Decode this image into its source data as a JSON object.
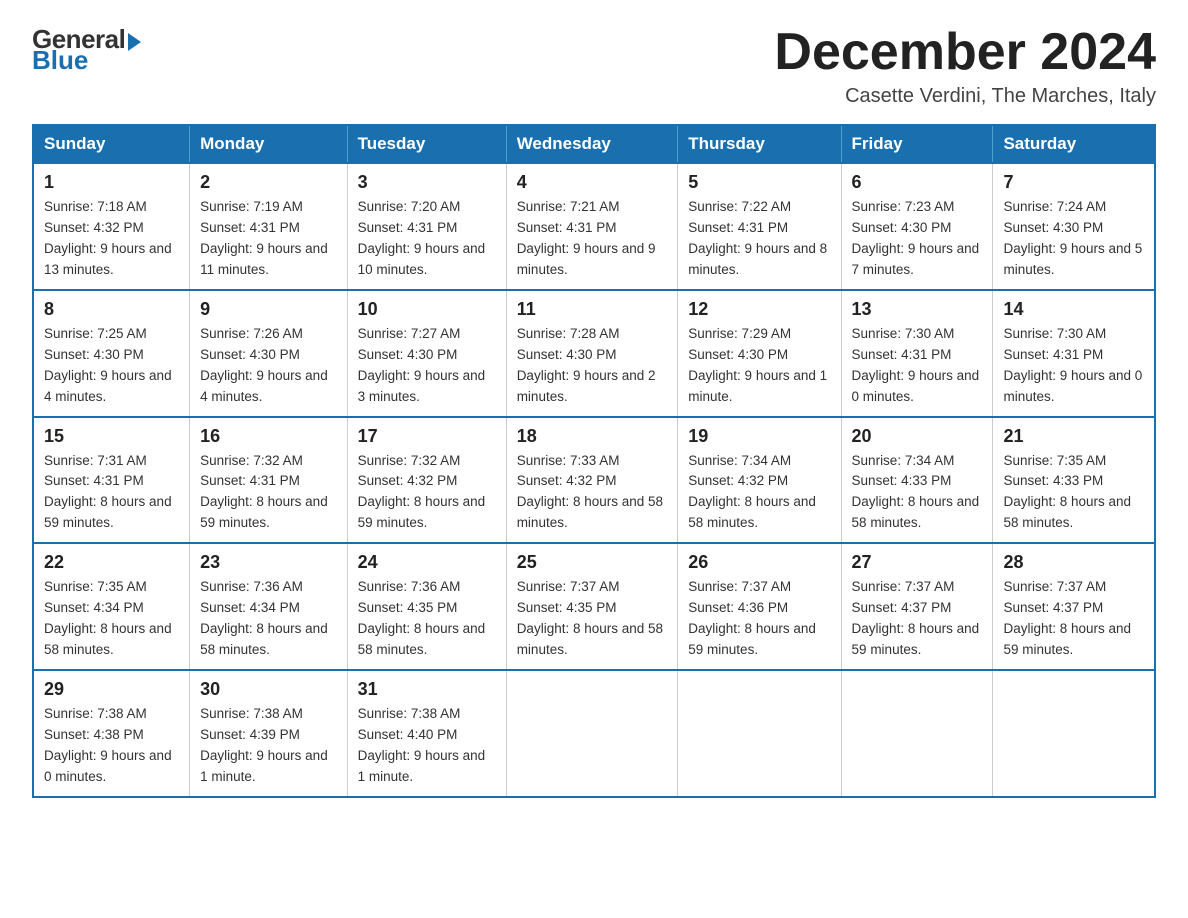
{
  "logo": {
    "general": "General",
    "blue": "Blue"
  },
  "title": "December 2024",
  "location": "Casette Verdini, The Marches, Italy",
  "headers": [
    "Sunday",
    "Monday",
    "Tuesday",
    "Wednesday",
    "Thursday",
    "Friday",
    "Saturday"
  ],
  "weeks": [
    [
      {
        "day": "1",
        "sunrise": "7:18 AM",
        "sunset": "4:32 PM",
        "daylight": "9 hours and 13 minutes."
      },
      {
        "day": "2",
        "sunrise": "7:19 AM",
        "sunset": "4:31 PM",
        "daylight": "9 hours and 11 minutes."
      },
      {
        "day": "3",
        "sunrise": "7:20 AM",
        "sunset": "4:31 PM",
        "daylight": "9 hours and 10 minutes."
      },
      {
        "day": "4",
        "sunrise": "7:21 AM",
        "sunset": "4:31 PM",
        "daylight": "9 hours and 9 minutes."
      },
      {
        "day": "5",
        "sunrise": "7:22 AM",
        "sunset": "4:31 PM",
        "daylight": "9 hours and 8 minutes."
      },
      {
        "day": "6",
        "sunrise": "7:23 AM",
        "sunset": "4:30 PM",
        "daylight": "9 hours and 7 minutes."
      },
      {
        "day": "7",
        "sunrise": "7:24 AM",
        "sunset": "4:30 PM",
        "daylight": "9 hours and 5 minutes."
      }
    ],
    [
      {
        "day": "8",
        "sunrise": "7:25 AM",
        "sunset": "4:30 PM",
        "daylight": "9 hours and 4 minutes."
      },
      {
        "day": "9",
        "sunrise": "7:26 AM",
        "sunset": "4:30 PM",
        "daylight": "9 hours and 4 minutes."
      },
      {
        "day": "10",
        "sunrise": "7:27 AM",
        "sunset": "4:30 PM",
        "daylight": "9 hours and 3 minutes."
      },
      {
        "day": "11",
        "sunrise": "7:28 AM",
        "sunset": "4:30 PM",
        "daylight": "9 hours and 2 minutes."
      },
      {
        "day": "12",
        "sunrise": "7:29 AM",
        "sunset": "4:30 PM",
        "daylight": "9 hours and 1 minute."
      },
      {
        "day": "13",
        "sunrise": "7:30 AM",
        "sunset": "4:31 PM",
        "daylight": "9 hours and 0 minutes."
      },
      {
        "day": "14",
        "sunrise": "7:30 AM",
        "sunset": "4:31 PM",
        "daylight": "9 hours and 0 minutes."
      }
    ],
    [
      {
        "day": "15",
        "sunrise": "7:31 AM",
        "sunset": "4:31 PM",
        "daylight": "8 hours and 59 minutes."
      },
      {
        "day": "16",
        "sunrise": "7:32 AM",
        "sunset": "4:31 PM",
        "daylight": "8 hours and 59 minutes."
      },
      {
        "day": "17",
        "sunrise": "7:32 AM",
        "sunset": "4:32 PM",
        "daylight": "8 hours and 59 minutes."
      },
      {
        "day": "18",
        "sunrise": "7:33 AM",
        "sunset": "4:32 PM",
        "daylight": "8 hours and 58 minutes."
      },
      {
        "day": "19",
        "sunrise": "7:34 AM",
        "sunset": "4:32 PM",
        "daylight": "8 hours and 58 minutes."
      },
      {
        "day": "20",
        "sunrise": "7:34 AM",
        "sunset": "4:33 PM",
        "daylight": "8 hours and 58 minutes."
      },
      {
        "day": "21",
        "sunrise": "7:35 AM",
        "sunset": "4:33 PM",
        "daylight": "8 hours and 58 minutes."
      }
    ],
    [
      {
        "day": "22",
        "sunrise": "7:35 AM",
        "sunset": "4:34 PM",
        "daylight": "8 hours and 58 minutes."
      },
      {
        "day": "23",
        "sunrise": "7:36 AM",
        "sunset": "4:34 PM",
        "daylight": "8 hours and 58 minutes."
      },
      {
        "day": "24",
        "sunrise": "7:36 AM",
        "sunset": "4:35 PM",
        "daylight": "8 hours and 58 minutes."
      },
      {
        "day": "25",
        "sunrise": "7:37 AM",
        "sunset": "4:35 PM",
        "daylight": "8 hours and 58 minutes."
      },
      {
        "day": "26",
        "sunrise": "7:37 AM",
        "sunset": "4:36 PM",
        "daylight": "8 hours and 59 minutes."
      },
      {
        "day": "27",
        "sunrise": "7:37 AM",
        "sunset": "4:37 PM",
        "daylight": "8 hours and 59 minutes."
      },
      {
        "day": "28",
        "sunrise": "7:37 AM",
        "sunset": "4:37 PM",
        "daylight": "8 hours and 59 minutes."
      }
    ],
    [
      {
        "day": "29",
        "sunrise": "7:38 AM",
        "sunset": "4:38 PM",
        "daylight": "9 hours and 0 minutes."
      },
      {
        "day": "30",
        "sunrise": "7:38 AM",
        "sunset": "4:39 PM",
        "daylight": "9 hours and 1 minute."
      },
      {
        "day": "31",
        "sunrise": "7:38 AM",
        "sunset": "4:40 PM",
        "daylight": "9 hours and 1 minute."
      },
      null,
      null,
      null,
      null
    ]
  ],
  "labels": {
    "sunrise": "Sunrise:",
    "sunset": "Sunset:",
    "daylight": "Daylight:"
  }
}
